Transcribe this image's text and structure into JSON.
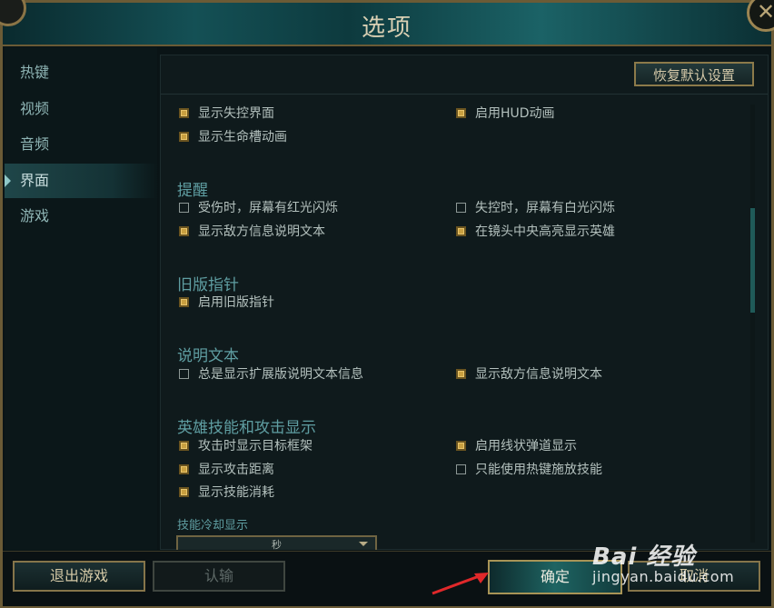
{
  "window": {
    "title": "选项",
    "close_icon": "close-icon"
  },
  "sidebar": {
    "items": [
      {
        "label": "热键",
        "active": false
      },
      {
        "label": "视频",
        "active": false
      },
      {
        "label": "音频",
        "active": false
      },
      {
        "label": "界面",
        "active": true
      },
      {
        "label": "游戏",
        "active": false
      }
    ]
  },
  "toolbar": {
    "reset_label": "恢复默认设置"
  },
  "general": {
    "show_lose_control_ui": {
      "label": "显示失控界面",
      "checked": true
    },
    "enable_hud_animation": {
      "label": "启用HUD动画",
      "checked": true
    },
    "show_health_bar_animation": {
      "label": "显示生命槽动画",
      "checked": true
    }
  },
  "reminders": {
    "title": "提醒",
    "damage_red_flash": {
      "label": "受伤时，屏幕有红光闪烁",
      "checked": false
    },
    "lose_control_white_flash": {
      "label": "失控时，屏幕有白光闪烁",
      "checked": false
    },
    "enemy_info_text": {
      "label": "显示敌方信息说明文本",
      "checked": true
    },
    "highlight_hero_center": {
      "label": "在镜头中央高亮显示英雄",
      "checked": true
    }
  },
  "legacy_cursor": {
    "title": "旧版指针",
    "enable_legacy_cursor": {
      "label": "启用旧版指针",
      "checked": true
    }
  },
  "tooltips": {
    "title": "说明文本",
    "always_show_extended": {
      "label": "总是显示扩展版说明文本信息",
      "checked": false
    },
    "show_enemy_info_text": {
      "label": "显示敌方信息说明文本",
      "checked": true
    }
  },
  "abilities": {
    "title": "英雄技能和攻击显示",
    "target_frame_on_attack": {
      "label": "攻击时显示目标框架",
      "checked": true
    },
    "linear_missile_display": {
      "label": "启用线状弹道显示",
      "checked": true
    },
    "show_attack_range": {
      "label": "显示攻击距离",
      "checked": true
    },
    "hotkey_only_cast": {
      "label": "只能使用热键施放技能",
      "checked": false
    },
    "show_ability_cost": {
      "label": "显示技能消耗",
      "checked": true
    },
    "cooldown_display_title": "技能冷却显示",
    "cooldown_display_value": "秒"
  },
  "footer": {
    "exit_game": "退出游戏",
    "surrender": "认输",
    "ok": "确定",
    "cancel": "取消"
  },
  "watermark": {
    "brand": "Bai 经验",
    "site": "jingyan.baidu.com"
  },
  "colors": {
    "accent_gold": "#c9a041",
    "section_teal": "#5f9ea2",
    "background": "#0f1a1c"
  }
}
